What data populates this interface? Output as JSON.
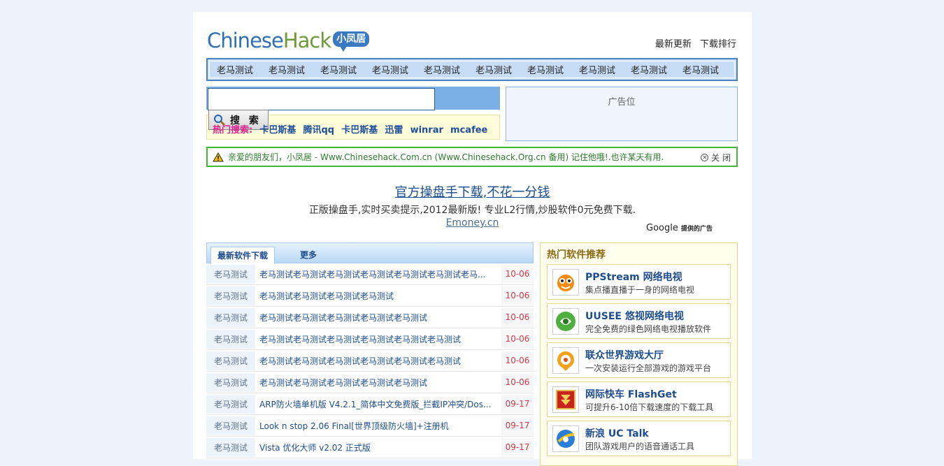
{
  "header": {
    "logo_part1": "Chinese",
    "logo_part2": "Hack",
    "logo_badge": "小凤居",
    "links": [
      "最新更新",
      "下载排行"
    ]
  },
  "nav": {
    "items": [
      "老马测试",
      "老马测试",
      "老马测试",
      "老马测试",
      "老马测试",
      "老马测试",
      "老马测试",
      "老马测试",
      "老马测试",
      "老马测试"
    ]
  },
  "search": {
    "value": "",
    "button_label": "搜 索",
    "hot_label": "热门搜索:",
    "keywords": [
      "卡巴斯基",
      "腾讯qq",
      "卡巴斯基",
      "迅雷",
      "winrar",
      "mcafee"
    ]
  },
  "ad_slot": {
    "label": "广告位"
  },
  "notice": {
    "text": "亲爱的朋友们，小凤居 - Www.Chinesehack.Com.cn (Www.Chinesehack.Org.cn 备用) 记住他哦!.也许某天有用.",
    "close_label": "关 闭"
  },
  "google_ad": {
    "title": "官方操盘手下载,不花一分钱",
    "description": "正版操盘手,实时买卖提示,2012最新版! 专业L2行情,炒股软件0元免费下载.",
    "url": "Emoney.cn",
    "brand": "Google",
    "brand_suffix": "提供的广告"
  },
  "latest": {
    "tab_label": "最新软件下载",
    "more_label": "更多",
    "rows": [
      {
        "cat": "老马测试",
        "title": "老马测试老马测试老马测试老马测试老马测试老马测试老马...",
        "date": "10-06"
      },
      {
        "cat": "老马测试",
        "title": "老马测试老马测试老马测试老马测试",
        "date": "10-06"
      },
      {
        "cat": "老马测试",
        "title": "老马测试老马测试老马测试老马测试老马测试",
        "date": "10-06"
      },
      {
        "cat": "老马测试",
        "title": "老马测试老马测试老马测试老马测试老马测试老马测试",
        "date": "10-06"
      },
      {
        "cat": "老马测试",
        "title": "老马测试老马测试老马测试老马测试老马测试老马测试",
        "date": "10-06"
      },
      {
        "cat": "老马测试",
        "title": "老马测试老马测试老马测试老马测试老马测试",
        "date": "10-06"
      },
      {
        "cat": "老马测试",
        "title": "ARP防火墙单机版 V4.2.1_简体中文免费版_拦截IP冲突/Dos...",
        "date": "09-17"
      },
      {
        "cat": "老马测试",
        "title": "Look n stop 2.06 Final[世界顶级防火墙]+注册机",
        "date": "09-17"
      },
      {
        "cat": "老马测试",
        "title": "Vista 优化大师 v2.02 正式版",
        "date": "09-17"
      }
    ]
  },
  "hot_software": {
    "title": "热门软件推荐",
    "items": [
      {
        "name": "PPStream 网络电视",
        "desc": "集点播直播于一身的网络电视",
        "icon": "ppstream-icon"
      },
      {
        "name": "UUSEE 悠视网络电视",
        "desc": "完全免费的绿色网络电视播放软件",
        "icon": "uusee-icon"
      },
      {
        "name": "联众世界游戏大厅",
        "desc": "一次安装运行全部游戏的游戏平台",
        "icon": "ourgame-icon"
      },
      {
        "name": "网际快车 FlashGet",
        "desc": "可提升6-10倍下载速度的下载工具",
        "icon": "flashget-icon"
      },
      {
        "name": "新浪 UC Talk",
        "desc": "团队游戏用户的语音通话工具",
        "icon": "uc-talk-icon"
      }
    ]
  }
}
